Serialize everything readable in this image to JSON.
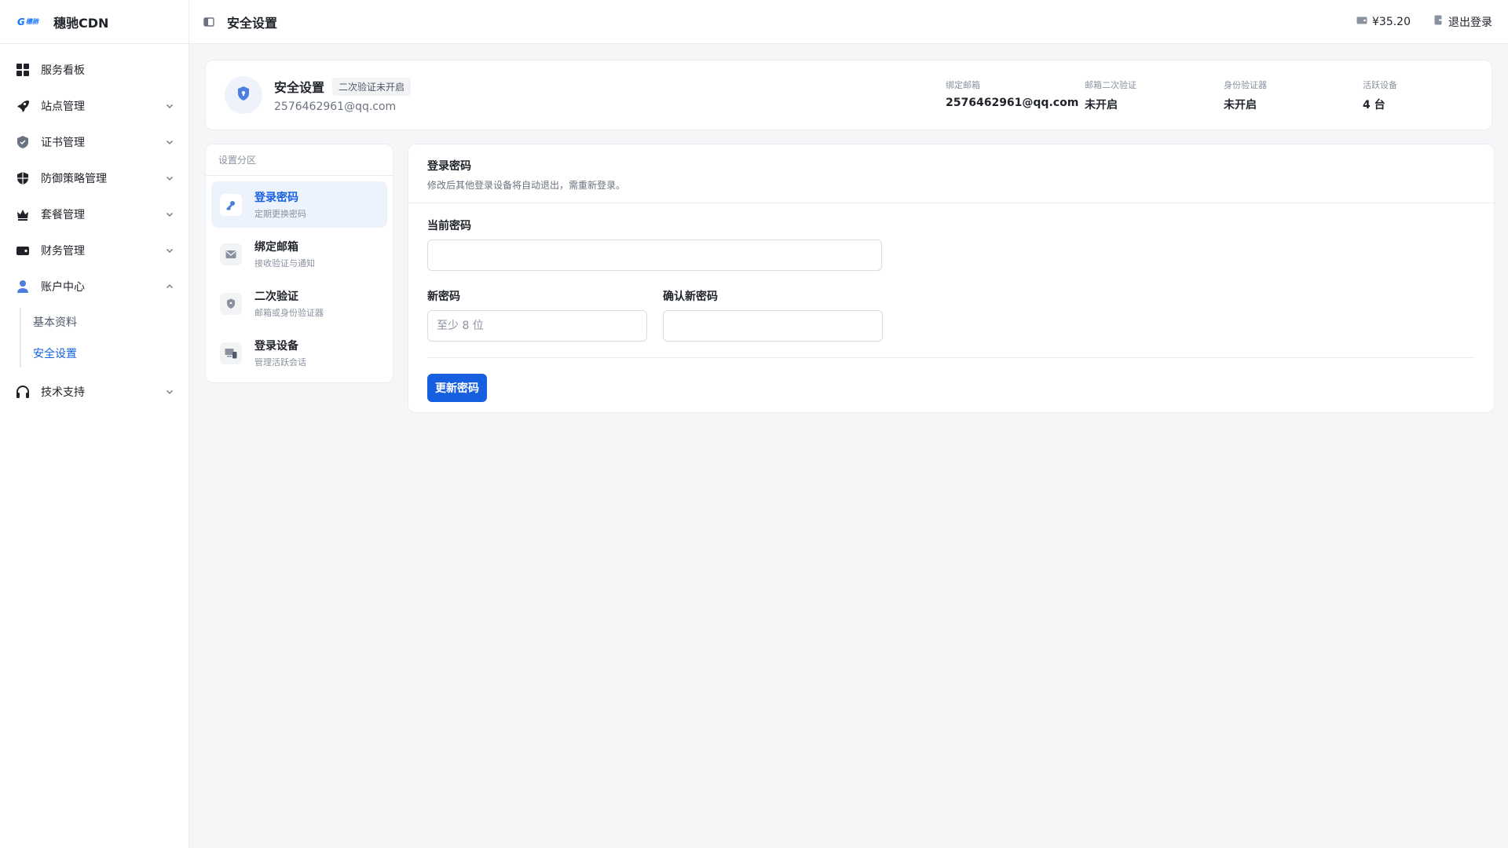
{
  "brand": {
    "logo_text": "穗驰",
    "name": "穗驰CDN"
  },
  "sidebar": {
    "items": [
      {
        "label": "服务看板",
        "icon": "dashboard-grid-icon"
      },
      {
        "label": "站点管理",
        "icon": "rocket-icon"
      },
      {
        "label": "证书管理",
        "icon": "certificate-shield-icon"
      },
      {
        "label": "防御策略管理",
        "icon": "defense-shield-icon"
      },
      {
        "label": "套餐管理",
        "icon": "crown-icon"
      },
      {
        "label": "财务管理",
        "icon": "wallet-icon"
      },
      {
        "label": "账户中心",
        "icon": "user-icon"
      },
      {
        "label": "技术支持",
        "icon": "headset-icon"
      }
    ],
    "account_sub": [
      {
        "label": "基本资料"
      },
      {
        "label": "安全设置"
      }
    ]
  },
  "topbar": {
    "title": "安全设置",
    "balance": "¥35.20",
    "logout": "退出登录"
  },
  "summary": {
    "title": "安全设置",
    "badge": "二次验证未开启",
    "email": "2576462961@qq.com",
    "stats": [
      {
        "label": "绑定邮箱",
        "value": "2576462961@qq.com"
      },
      {
        "label": "邮箱二次验证",
        "value": "未开启"
      },
      {
        "label": "身份验证器",
        "value": "未开启"
      },
      {
        "label": "活跃设备",
        "value": "4 台"
      }
    ]
  },
  "sections": {
    "heading": "设置分区",
    "items": [
      {
        "title": "登录密码",
        "sub": "定期更换密码"
      },
      {
        "title": "绑定邮箱",
        "sub": "接收验证与通知"
      },
      {
        "title": "二次验证",
        "sub": "邮箱或身份验证器"
      },
      {
        "title": "登录设备",
        "sub": "管理活跃会话"
      }
    ]
  },
  "panel": {
    "title": "登录密码",
    "desc": "修改后其他登录设备将自动退出，需重新登录。",
    "current_label": "当前密码",
    "current_value": "",
    "new_label": "新密码",
    "new_placeholder": "至少 8 位",
    "confirm_label": "确认新密码",
    "confirm_value": "",
    "submit": "更新密码"
  },
  "colors": {
    "accent": "#1660e0",
    "accent_bg": "#edf3fd"
  }
}
